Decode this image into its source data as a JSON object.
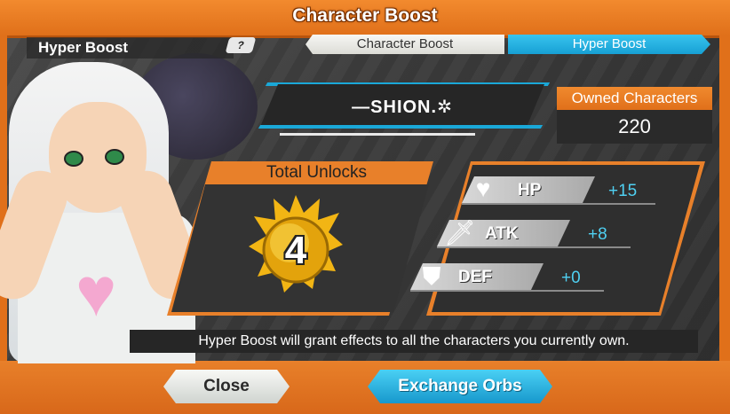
{
  "window": {
    "title": "Character Boost"
  },
  "side": {
    "mode_label": "Hyper Boost",
    "help_label": "?"
  },
  "tabs": [
    {
      "label": "Character Boost",
      "active": false
    },
    {
      "label": "Hyper Boost",
      "active": true
    }
  ],
  "character": {
    "name": "SHION"
  },
  "owned": {
    "label": "Owned Characters",
    "value": "220"
  },
  "unlocks": {
    "title": "Total Unlocks",
    "value": "4"
  },
  "stats": [
    {
      "name": "HP",
      "value": "+15",
      "icon": "heart-icon"
    },
    {
      "name": "ATK",
      "value": "+8",
      "icon": "sword-icon"
    },
    {
      "name": "DEF",
      "value": "+0",
      "icon": "armor-icon"
    }
  ],
  "info": {
    "text": "Hyper Boost will grant effects to all the characters you currently own."
  },
  "buttons": {
    "close": "Close",
    "exchange": "Exchange Orbs"
  },
  "colors": {
    "orange": "#e8802a",
    "cyan": "#1aa8d8",
    "stat_value": "#4fd0f2"
  }
}
